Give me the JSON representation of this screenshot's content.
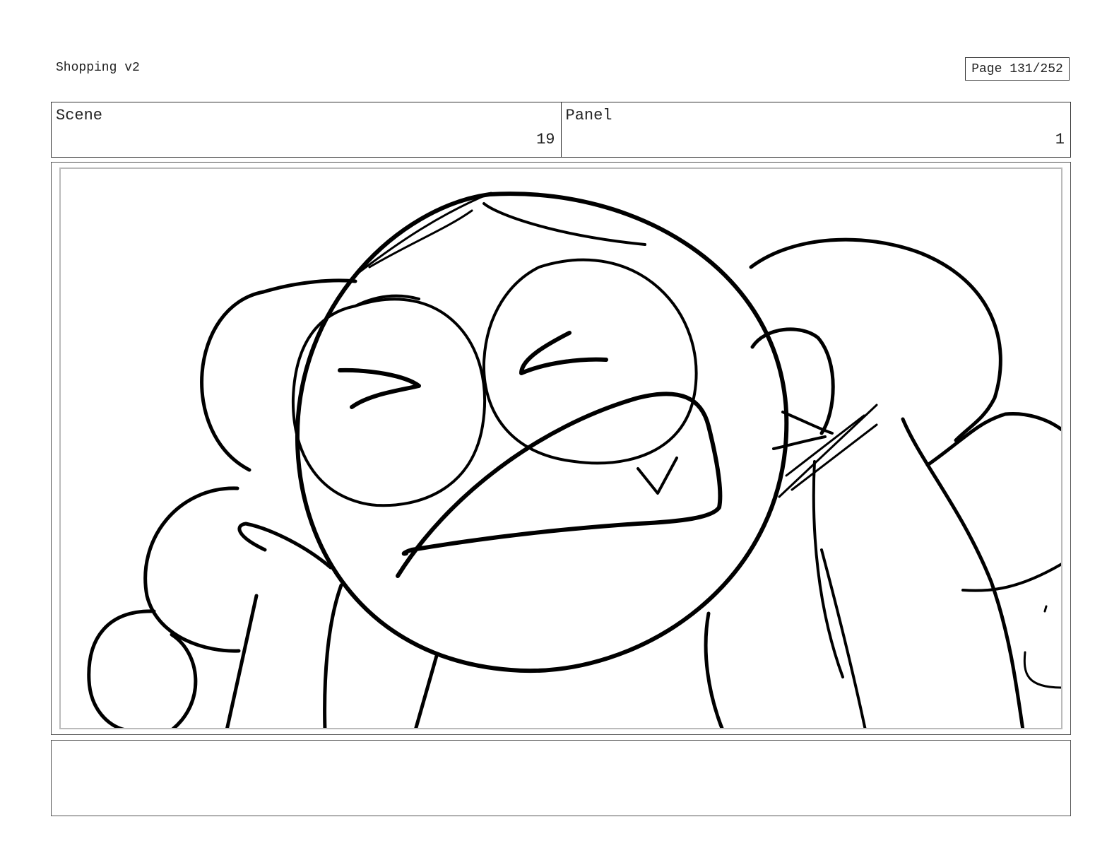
{
  "header": {
    "project_title": "Shopping v2",
    "page_label": "Page 131/252"
  },
  "info": {
    "scene_label": "Scene",
    "scene_number": "19",
    "panel_label": "Panel",
    "panel_number": "1"
  },
  "notes": {
    "text": ""
  }
}
